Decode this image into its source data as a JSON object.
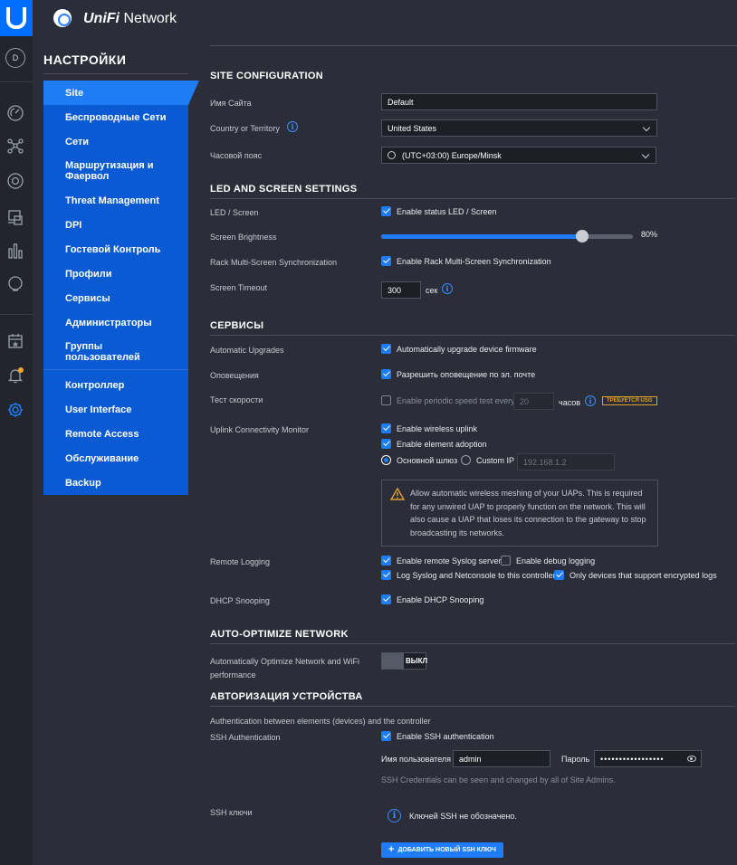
{
  "app": {
    "brand": "UniFi",
    "product": "Network",
    "avatar_letter": "D"
  },
  "rail": {
    "items": [
      "dashboard-icon",
      "topology-icon",
      "devices-icon",
      "clients-icon",
      "statistics-icon",
      "insights-icon",
      "events-icon",
      "alerts-icon",
      "settings-icon"
    ],
    "alert_dot_color": "#f5a623"
  },
  "nav": {
    "title": "НАСТРОЙКИ",
    "items": [
      {
        "label": "Site"
      },
      {
        "label": "Беспроводные Сети"
      },
      {
        "label": "Сети"
      },
      {
        "label": "Маршрутизация и Фаервол"
      },
      {
        "label": "Threat Management"
      },
      {
        "label": "DPI"
      },
      {
        "label": "Гостевой Контроль"
      },
      {
        "label": "Профили"
      },
      {
        "label": "Сервисы"
      },
      {
        "label": "Администраторы"
      },
      {
        "label": "Группы пользователей"
      },
      {
        "label": "Контроллер"
      },
      {
        "label": "User Interface"
      },
      {
        "label": "Remote Access"
      },
      {
        "label": "Обслуживание"
      },
      {
        "label": "Backup"
      }
    ]
  },
  "site_config": {
    "heading": "SITE CONFIGURATION",
    "site_name_label": "Имя Сайта",
    "site_name_value": "Default",
    "country_label": "Country or Territory",
    "country_value": "United States",
    "timezone_label": "Часовой пояс",
    "timezone_value": "(UTC+03:00) Europe/Minsk"
  },
  "led": {
    "heading": "LED AND SCREEN SETTINGS",
    "led_label": "LED / Screen",
    "led_option": "Enable status LED / Screen",
    "brightness_label": "Screen Brightness",
    "brightness_value": "80%",
    "brightness_fraction": 0.8,
    "rack_label": "Rack Multi-Screen Synchronization",
    "rack_option": "Enable Rack Multi-Screen Synchronization",
    "timeout_label": "Screen Timeout",
    "timeout_value": "300",
    "timeout_unit": "сек"
  },
  "services": {
    "heading": "СЕРВИСЫ",
    "upgrades_label": "Automatic Upgrades",
    "upgrades_option": "Automatically upgrade device firmware",
    "alerts_label": "Оповещения",
    "alerts_option": "Разрешить оповещение по эл. почте",
    "speed_label": "Тест скорости",
    "speed_option": "Enable periodic speed test every",
    "speed_value": "20",
    "speed_unit": "часов",
    "speed_badge": "ТРЕБУЕТСЯ USG",
    "uplink_label": "Uplink Connectivity Monitor",
    "uplink_wireless": "Enable wireless uplink",
    "uplink_adoption": "Enable element adoption",
    "radio_gateway": "Основной шлюз",
    "radio_custom": "Custom IP",
    "custom_ip_placeholder": "192.168.1.2",
    "warning_text": "Allow automatic wireless meshing of your UAPs. This is required for any unwired UAP to properly function on the network. This will also cause a UAP that loses its connection to the gateway to stop broadcasting its networks.",
    "logging_label": "Remote Logging",
    "logging_syslog": "Enable remote Syslog server",
    "logging_debug": "Enable debug logging",
    "logging_netconsole": "Log Syslog and Netconsole to this controller",
    "logging_encrypted": "Only devices that support encrypted logs",
    "dhcp_label": "DHCP Snooping",
    "dhcp_option": "Enable DHCP Snooping"
  },
  "auto_opt": {
    "heading": "AUTO-OPTIMIZE NETWORK",
    "label": "Automatically Optimize Network and WiFi performance",
    "toggle_label": "ВЫКЛ"
  },
  "auth": {
    "heading": "АВТОРИЗАЦИЯ УСТРОЙСТВА",
    "description": "Authentication between elements (devices) and the controller",
    "ssh_label": "SSH Authentication",
    "ssh_option": "Enable SSH authentication",
    "username_label": "Имя пользователя",
    "username_value": "admin",
    "password_label": "Пароль",
    "password_value": "•••••••••••••••••",
    "credentials_note": "SSH Credentials can be seen and changed by all of Site Admins.",
    "keys_label": "SSH ключи",
    "keys_empty": "Ключей SSH не обозначено.",
    "add_key_button": "ДОБАВИТЬ НОВЫЙ SSH КЛЮЧ"
  }
}
